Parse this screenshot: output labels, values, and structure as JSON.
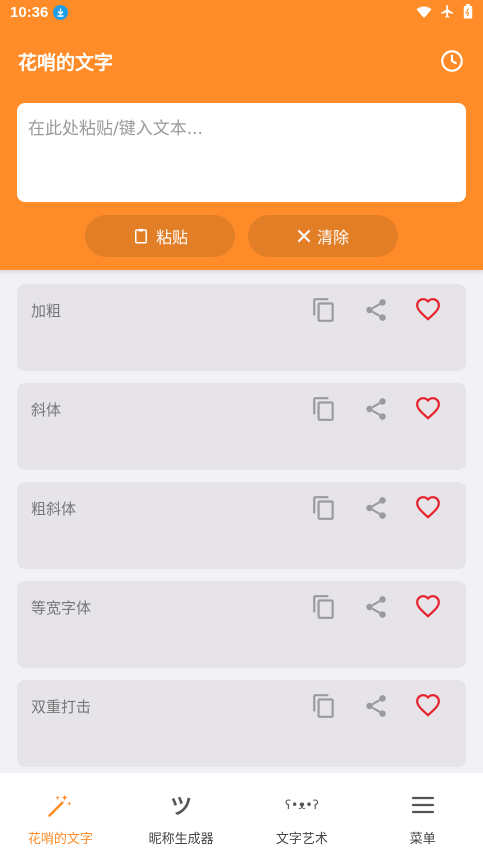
{
  "status": {
    "time": "10:36"
  },
  "app": {
    "title": "花哨的文字"
  },
  "input": {
    "placeholder": "在此处粘贴/键入文本...",
    "value": ""
  },
  "actions": {
    "paste_label": "粘贴",
    "clear_label": "清除"
  },
  "styles": [
    {
      "label": "加粗"
    },
    {
      "label": "斜体"
    },
    {
      "label": "粗斜体"
    },
    {
      "label": "等宽字体"
    },
    {
      "label": "双重打击"
    }
  ],
  "nav": [
    {
      "label": "花哨的文字",
      "icon": "magic-wand-icon",
      "active": true
    },
    {
      "label": "昵称生成器",
      "icon": "tsu-icon",
      "active": false
    },
    {
      "label": "文字艺术",
      "icon": "kaomoji-icon",
      "active": false
    },
    {
      "label": "菜单",
      "icon": "menu-icon",
      "active": false
    }
  ],
  "colors": {
    "accent": "#ff8c28",
    "button": "#e27e26",
    "heart": "#e8202a",
    "card": "#e6e3e9"
  }
}
